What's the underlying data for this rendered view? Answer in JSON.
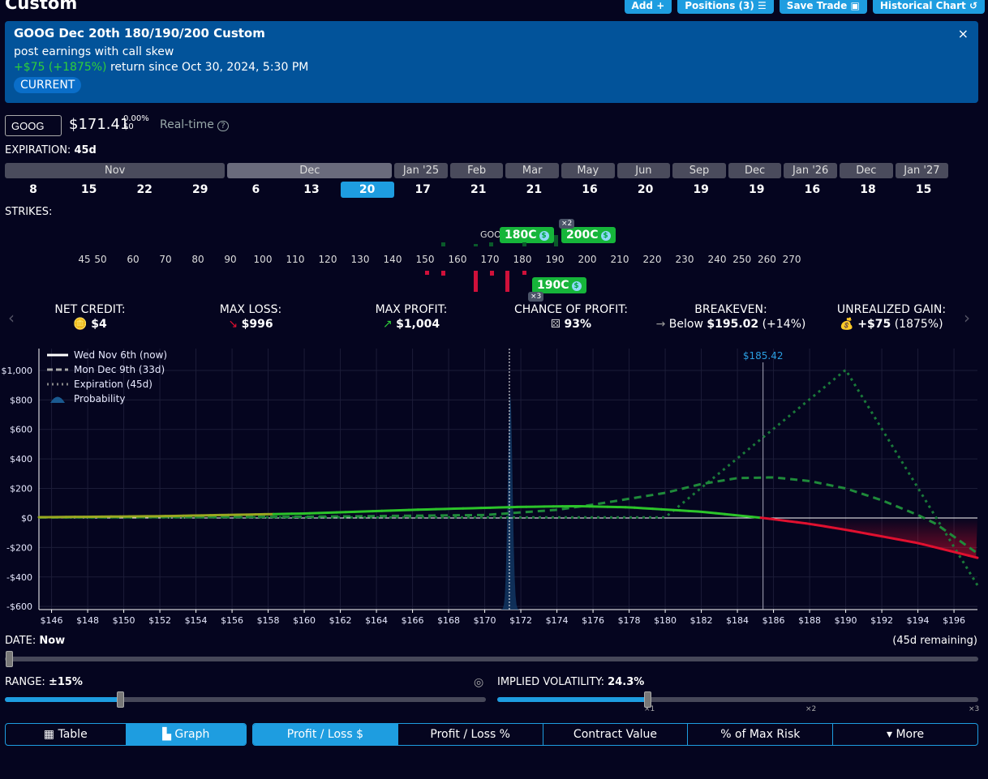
{
  "header": {
    "title": "Custom",
    "buttons": [
      {
        "label": "Add",
        "icon": "plus-icon"
      },
      {
        "label": "Positions (3)",
        "icon": "list-icon"
      },
      {
        "label": "Save Trade",
        "icon": "save-icon"
      },
      {
        "label": "Historical Chart",
        "icon": "history-icon"
      }
    ]
  },
  "banner": {
    "title": "GOOG Dec 20th 180/190/200 Custom",
    "note": "post earnings with call skew",
    "return_value": "+$75 (+1875%)",
    "return_text": " return since Oct 30, 2024, 5:30 PM",
    "badge": "CURRENT",
    "close": "×"
  },
  "quote": {
    "symbol": "GOOG",
    "price": "$171.41",
    "change_pct": "0.00%",
    "change_abs": "$0",
    "realtime": "Real-time",
    "help": "?"
  },
  "expiration": {
    "label": "EXPIRATION:",
    "value": "45d",
    "months": [
      {
        "label": "Nov",
        "span": 4
      },
      {
        "label": "Dec",
        "span": 3,
        "selected": true
      },
      {
        "label": "Jan '25",
        "span": 1
      },
      {
        "label": "Feb",
        "span": 1
      },
      {
        "label": "Mar",
        "span": 1
      },
      {
        "label": "May",
        "span": 1
      },
      {
        "label": "Jun",
        "span": 1
      },
      {
        "label": "Sep",
        "span": 1
      },
      {
        "label": "Dec",
        "span": 1
      },
      {
        "label": "Jan '26",
        "span": 1
      },
      {
        "label": "Dec",
        "span": 1
      },
      {
        "label": "Jan '27",
        "span": 1
      }
    ],
    "days": [
      "8",
      "15",
      "22",
      "29",
      "6",
      "13",
      "20",
      "17",
      "21",
      "21",
      "16",
      "20",
      "19",
      "19",
      "16",
      "18",
      "15"
    ],
    "selected_day_index": 6
  },
  "strikes": {
    "label": "STRIKES:",
    "ticks": [
      "45",
      "50",
      "60",
      "70",
      "80",
      "90",
      "100",
      "110",
      "120",
      "130",
      "140",
      "150",
      "160",
      "170",
      "180",
      "190",
      "200",
      "210",
      "220",
      "230",
      "240",
      "250",
      "260",
      "270"
    ],
    "underlying": "GOOG",
    "legs": [
      {
        "label": "180C",
        "strike": 180,
        "side": "long",
        "qty": "1"
      },
      {
        "label": "200C",
        "strike": 200,
        "side": "long",
        "qty": "×2"
      },
      {
        "label": "190C",
        "strike": 190,
        "side": "short",
        "qty": "×3"
      }
    ]
  },
  "stats": [
    {
      "label": "NET CREDIT:",
      "icon": "coins-icon",
      "value": "$4",
      "extra": ""
    },
    {
      "label": "MAX LOSS:",
      "icon": "arrow-down-right-icon",
      "value": "$996",
      "extra": ""
    },
    {
      "label": "MAX PROFIT:",
      "icon": "arrow-up-right-icon",
      "value": "$1,004",
      "extra": ""
    },
    {
      "label": "CHANCE OF PROFIT:",
      "icon": "dice-icon",
      "value": "93%",
      "extra": ""
    },
    {
      "label": "BREAKEVEN:",
      "icon": "arrow-right-icon",
      "prefix": "Below ",
      "value": "$195.02",
      "extra": " (+14%)"
    },
    {
      "label": "UNREALIZED GAIN:",
      "icon": "money-bag-icon",
      "value": "+$75",
      "extra": " (1875%)"
    }
  ],
  "chart_data": {
    "type": "line",
    "xlim": [
      145.3,
      197.3
    ],
    "ylim": [
      -621,
      1148
    ],
    "xticks": [
      "$146",
      "$148",
      "$150",
      "$152",
      "$154",
      "$156",
      "$158",
      "$160",
      "$162",
      "$164",
      "$166",
      "$168",
      "$170",
      "$172",
      "$174",
      "$176",
      "$178",
      "$180",
      "$182",
      "$184",
      "$186",
      "$188",
      "$190",
      "$192",
      "$194",
      "$196"
    ],
    "yticks": [
      "$1,000",
      "$800",
      "$600",
      "$400",
      "$200",
      "$0",
      "-$200",
      "-$400",
      "-$600"
    ],
    "grid": true,
    "legend_placement": "top-left",
    "marker_label": "$185.42",
    "marker_x": 185.42,
    "current_price": 171.41,
    "series": [
      {
        "name": "Wed Nov 6th (now)",
        "style": "solid",
        "points": [
          [
            145.3,
            5
          ],
          [
            152,
            12
          ],
          [
            160,
            30
          ],
          [
            166,
            55
          ],
          [
            172,
            75
          ],
          [
            175,
            80
          ],
          [
            178,
            72
          ],
          [
            182,
            42
          ],
          [
            185.42,
            0
          ],
          [
            188,
            -40
          ],
          [
            190,
            -80
          ],
          [
            194,
            -170
          ],
          [
            197.3,
            -270
          ]
        ]
      },
      {
        "name": "Mon Dec 9th (33d)",
        "style": "dashed",
        "points": [
          [
            145.3,
            3
          ],
          [
            160,
            8
          ],
          [
            170,
            20
          ],
          [
            174,
            55
          ],
          [
            176,
            90
          ],
          [
            178,
            130
          ],
          [
            180,
            170
          ],
          [
            182,
            230
          ],
          [
            184,
            270
          ],
          [
            186,
            275
          ],
          [
            188,
            250
          ],
          [
            190,
            200
          ],
          [
            192,
            120
          ],
          [
            194,
            20
          ],
          [
            195,
            -40
          ],
          [
            197.3,
            -240
          ]
        ]
      },
      {
        "name": "Expiration (45d)",
        "style": "dotted",
        "points": [
          [
            145.3,
            4
          ],
          [
            180,
            4
          ],
          [
            190,
            1004
          ],
          [
            197.3,
            -456
          ]
        ]
      },
      {
        "name": "Probability",
        "style": "area",
        "center": 171.41,
        "peak": 850
      }
    ]
  },
  "date": {
    "label": "DATE:",
    "value": "Now",
    "remaining": "(45d remaining)",
    "position": 0
  },
  "range": {
    "label": "RANGE:",
    "value": "±15%",
    "position": 0.24
  },
  "iv": {
    "label": "IMPLIED VOLATILITY:",
    "value": "24.3%",
    "position": 0.32,
    "marks": [
      "×1",
      "×2",
      "×3"
    ]
  },
  "view_tabs": [
    {
      "label": "Table",
      "icon": "table-icon"
    },
    {
      "label": "Graph",
      "icon": "chart-icon",
      "active": true
    }
  ],
  "metric_tabs": [
    {
      "label": "Profit / Loss $",
      "active": true
    },
    {
      "label": "Profit / Loss %"
    },
    {
      "label": "Contract Value"
    },
    {
      "label": "% of Max Risk"
    },
    {
      "label": "▾ More"
    }
  ],
  "colors": {
    "accent": "#1e9de0",
    "profit": "#16b53a",
    "loss": "#e0102f",
    "banner": "#02539a"
  }
}
